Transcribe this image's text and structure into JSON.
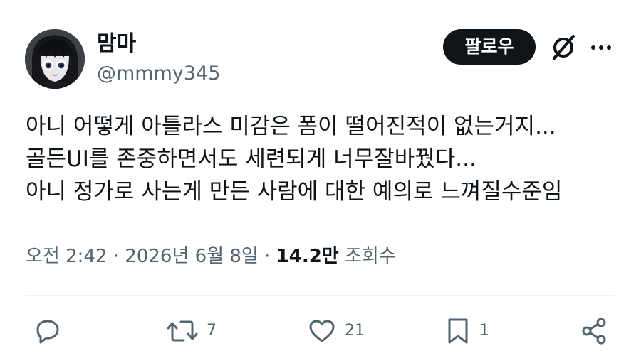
{
  "user": {
    "display_name": "맘마",
    "handle": "@mmmy345",
    "avatar_icon": "anime-avatar"
  },
  "header": {
    "follow_label": "팔로우",
    "grok_icon": "grok-icon",
    "more_icon": "more-icon"
  },
  "tweet": {
    "lines": [
      "아니 어떻게 아틀라스 미감은 폼이 떨어진적이 없는거지...",
      "골든UI를 존중하면서도 세련되게 너무잘바꿨다...",
      "아니 정가로 사는게 만든 사람에 대한 예의로 느껴질수준임"
    ]
  },
  "meta": {
    "time": "오전 2:42",
    "separator": "·",
    "date": "2026년 6월 8일",
    "views_count": "14.2만",
    "views_label": "조회수"
  },
  "actions": {
    "reply": {
      "icon": "reply-icon",
      "count": ""
    },
    "retweet": {
      "icon": "retweet-icon",
      "count": "7"
    },
    "like": {
      "icon": "heart-icon",
      "count": "21"
    },
    "bookmark": {
      "icon": "bookmark-icon",
      "count": "1"
    },
    "share": {
      "icon": "share-icon",
      "count": ""
    }
  },
  "colors": {
    "text_primary": "#0f1419",
    "text_secondary": "#536471",
    "divider": "#eff3f4",
    "button_bg": "#0f1419"
  }
}
